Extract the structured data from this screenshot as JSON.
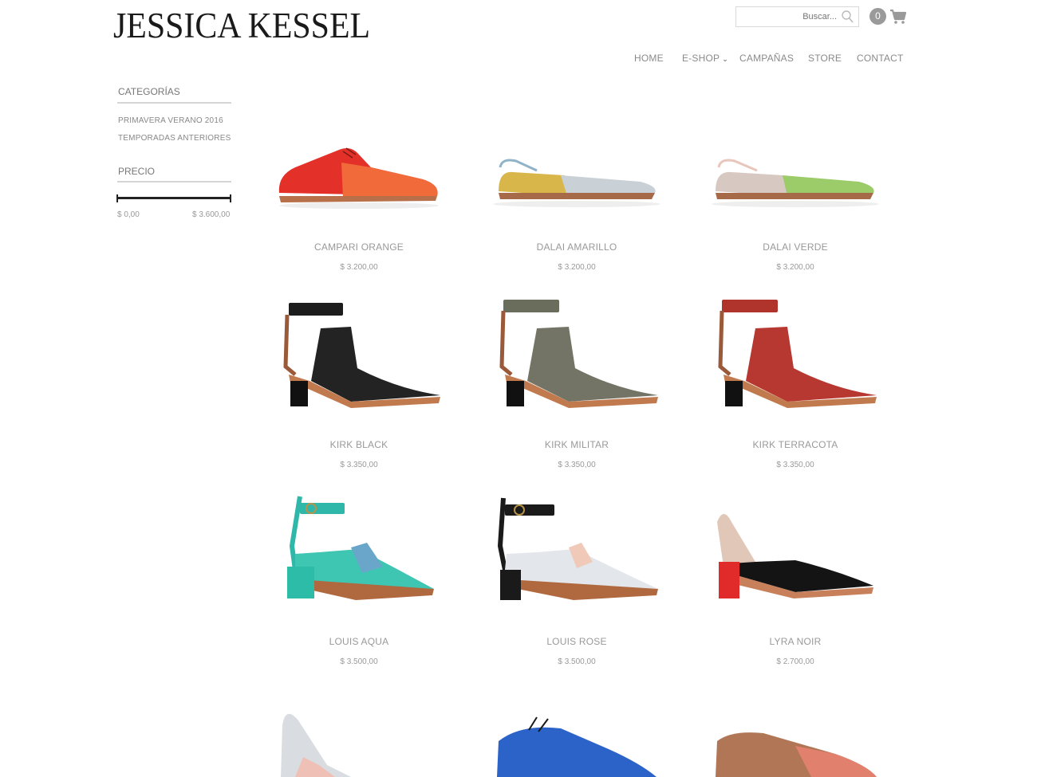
{
  "brand": {
    "logo_text": "JESSICA KESSEL"
  },
  "header": {
    "search_placeholder": "Buscar...",
    "cart_count": "0"
  },
  "nav": {
    "items": [
      {
        "label": "HOME"
      },
      {
        "label": "E-SHOP"
      },
      {
        "label": "CAMPAÑAS"
      },
      {
        "label": "STORE"
      },
      {
        "label": "CONTACT"
      }
    ]
  },
  "sidebar": {
    "categories_title": "CATEGORÍAS",
    "categories": [
      {
        "label": "PRIMAVERA VERANO 2016"
      },
      {
        "label": "TEMPORADAS ANTERIORES"
      }
    ],
    "price_title": "PRECIO",
    "price_min": "$ 0,00",
    "price_max": "$ 3.600,00"
  },
  "colors": {
    "accent": "#1a1a1a",
    "text_muted": "#999999",
    "badge": "#9a9a9a"
  },
  "products": [
    {
      "name": "CAMPARI ORANGE",
      "price": "$ 3.200,00"
    },
    {
      "name": "DALAI AMARILLO",
      "price": "$ 3.200,00"
    },
    {
      "name": "DALAI VERDE",
      "price": "$ 3.200,00"
    },
    {
      "name": "KIRK BLACK",
      "price": "$ 3.350,00"
    },
    {
      "name": "KIRK MILITAR",
      "price": "$ 3.350,00"
    },
    {
      "name": "KIRK TERRACOTA",
      "price": "$ 3.350,00"
    },
    {
      "name": "LOUIS AQUA",
      "price": "$ 3.500,00"
    },
    {
      "name": "LOUIS ROSE",
      "price": "$ 3.500,00"
    },
    {
      "name": "LYRA NOIR",
      "price": "$ 2.700,00"
    }
  ]
}
